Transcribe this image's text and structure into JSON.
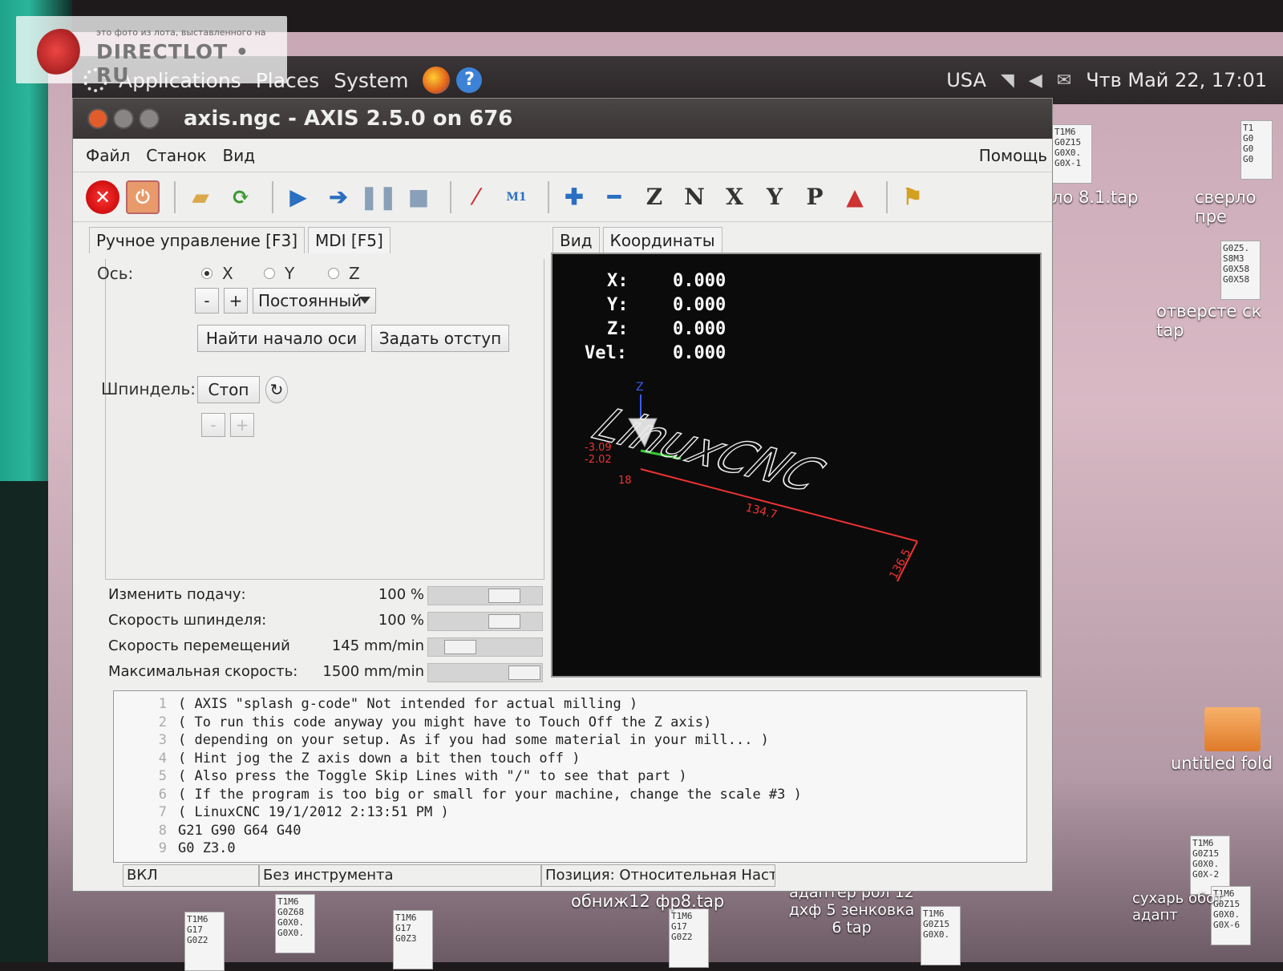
{
  "watermark": {
    "small": "это фото из лота, выставленного на",
    "big": "DIRECTLOT • RU"
  },
  "topbar": {
    "menus": [
      "Applications",
      "Places",
      "System"
    ],
    "keyboard": "USA",
    "clock": "Чтв Май 22, 17:01"
  },
  "window": {
    "title": "axis.ngc - AXIS 2.5.0 on 676",
    "menu": [
      "Файл",
      "Станок",
      "Вид"
    ],
    "help_menu": "Помощь",
    "toolbar_icons": [
      "estop-icon",
      "power-icon",
      "open-file-icon",
      "reload-icon",
      "run-icon",
      "step-icon",
      "pause-icon",
      "stop-icon",
      "block-delete-icon",
      "optional-stop-icon",
      "zoom-in-icon",
      "zoom-out-icon",
      "view-z-icon",
      "view-z2-icon",
      "view-x-icon",
      "view-y-icon",
      "view-p-icon",
      "rotate-icon",
      "clear-plot-icon"
    ]
  },
  "toolbar_labels": {
    "view_z": "Z",
    "view_z2": "N",
    "view_x": "X",
    "view_y": "Y",
    "view_p": "P",
    "m1": "M1"
  },
  "tabs": {
    "manual": "Ручное управление [F3]",
    "mdi": "MDI [F5]"
  },
  "manual": {
    "axis_label": "Ось:",
    "axes": [
      "X",
      "Y",
      "Z"
    ],
    "selected_axis": "X",
    "minus": "-",
    "plus": "+",
    "jog_mode": "Постоянный",
    "home_button": "Найти начало оси",
    "touch_off_button": "Задать отступ",
    "spindle_label": "Шпиндель:",
    "spindle_stop": "Стоп"
  },
  "overrides": [
    {
      "label": "Изменить подачу:",
      "value": "100 %",
      "level": 0.75
    },
    {
      "label": "Скорость шпинделя:",
      "value": "100 %",
      "level": 0.75
    },
    {
      "label": "Скорость перемещений",
      "value": "145 mm/min",
      "level": 0.2
    },
    {
      "label": "Максимальная скорость:",
      "value": "1500 mm/min",
      "level": 1.0
    }
  ],
  "preview_tabs": {
    "view": "Вид",
    "coords": "Координаты"
  },
  "dro": [
    {
      "axis": "X:",
      "value": "0.000"
    },
    {
      "axis": "Y:",
      "value": "0.000"
    },
    {
      "axis": "Z:",
      "value": "0.000"
    },
    {
      "axis": "Vel:",
      "value": "0.000"
    }
  ],
  "preview": {
    "text": "LinuxCNC",
    "dim_x": "134.7",
    "dim_y": "136.5",
    "z_label": "Z",
    "dim_left_1": "-3.09",
    "dim_left_2": "-2.02",
    "dim_left_3": "18"
  },
  "gcode": [
    {
      "n": "1",
      "t": "( AXIS \"splash g-code\" Not intended for actual milling )"
    },
    {
      "n": "2",
      "t": "( To run this code anyway you might have to Touch Off the Z axis)"
    },
    {
      "n": "3",
      "t": "( depending on your setup. As if you had some material in your mill... )"
    },
    {
      "n": "4",
      "t": "( Hint jog the Z axis down a bit then touch off )"
    },
    {
      "n": "5",
      "t": "( Also press the Toggle Skip Lines with \"/\" to see that part )"
    },
    {
      "n": "6",
      "t": "( If the program is too big or small for your machine, change the scale #3 )"
    },
    {
      "n": "7",
      "t": "( LinuxCNC 19/1/2012 2:13:51 PM )"
    },
    {
      "n": "8",
      "t": "G21 G90 G64 G40"
    },
    {
      "n": "9",
      "t": "G0 Z3.0"
    }
  ],
  "status": {
    "state": "ВКЛ",
    "tool": "Без инструмента",
    "position": "Позиция: Относительная Насто"
  },
  "desktop": {
    "labels": [
      "ло 8.1.tap",
      "сверло пре",
      "отверсте ск tap",
      "untitled fold",
      "обниж12 фр8.tap",
      "адаптер рол 12 дхф 5 зенковка 6 tap",
      "сухарь обот адапт"
    ],
    "files": [
      "T1M6\nG0Z15\nG0X0.\nG0X-1",
      "T1\nG0\nG0\nG0",
      "G0Z5.\nS8M3\nG0X58\nG0X58",
      "T1M6\nG0Z15\nG0X0.\nG0X-2",
      "T1M6\nG0Z68\nG0X0.\nG0X0.",
      "T1M6\nG17\nG0Z2",
      "T1M6\nG17\nG0Z3",
      "T1M6\nG17\nG0Z2",
      "T1M6\nG0Z15\nG0X0.",
      "T1M6\nG0Z15\nG0X0.\nG0X-6"
    ]
  }
}
